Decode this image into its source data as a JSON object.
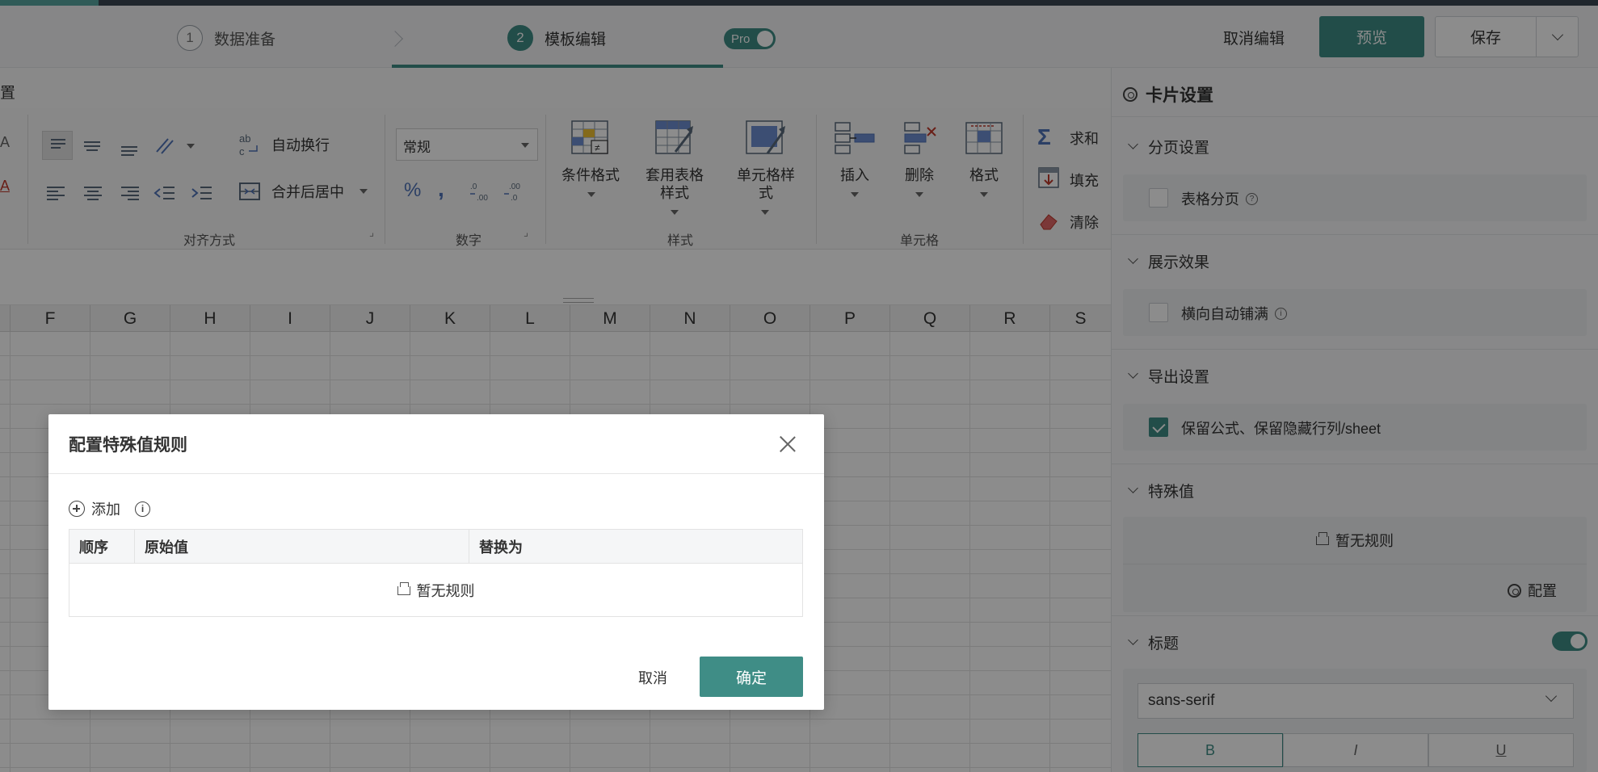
{
  "header": {
    "steps": [
      {
        "num": "1",
        "label": "数据准备"
      },
      {
        "num": "2",
        "label": "模板编辑"
      }
    ],
    "pro_label": "Pro",
    "cancel_edit": "取消编辑",
    "preview": "预览",
    "save": "保存"
  },
  "sheet": {
    "subtitle": "置",
    "ribbon": {
      "auto_wrap": "自动换行",
      "merge_center": "合并后居中",
      "number_format": "常规",
      "cond_format": "条件格式",
      "table_style_1": "套用表格",
      "table_style_2": "样式",
      "cell_style_1": "单元格样",
      "cell_style_2": "式",
      "insert": "插入",
      "delete": "删除",
      "format": "格式",
      "sum": "求和",
      "fill": "填充",
      "clear": "清除",
      "groups": {
        "align": "对齐方式",
        "number": "数字",
        "style": "样式",
        "cell": "单元格"
      }
    },
    "columns": [
      "F",
      "G",
      "H",
      "I",
      "J",
      "K",
      "L",
      "M",
      "N",
      "O",
      "P",
      "Q",
      "R",
      "S"
    ]
  },
  "panel": {
    "title": "卡片设置",
    "sections": {
      "paging": {
        "title": "分页设置",
        "option": "表格分页"
      },
      "display": {
        "title": "展示效果",
        "option": "横向自动铺满"
      },
      "export": {
        "title": "导出设置",
        "option": "保留公式、保留隐藏行列/sheet"
      },
      "special": {
        "title": "特殊值",
        "empty": "暂无规则",
        "config": "配置"
      },
      "heading": {
        "title": "标题",
        "font": "sans-serif",
        "bold": "B",
        "italic": "I",
        "underline": "U"
      }
    }
  },
  "modal": {
    "title": "配置特殊值规则",
    "add": "添加",
    "columns": [
      "顺序",
      "原始值",
      "替换为"
    ],
    "empty": "暂无规则",
    "cancel": "取消",
    "confirm": "确定"
  }
}
